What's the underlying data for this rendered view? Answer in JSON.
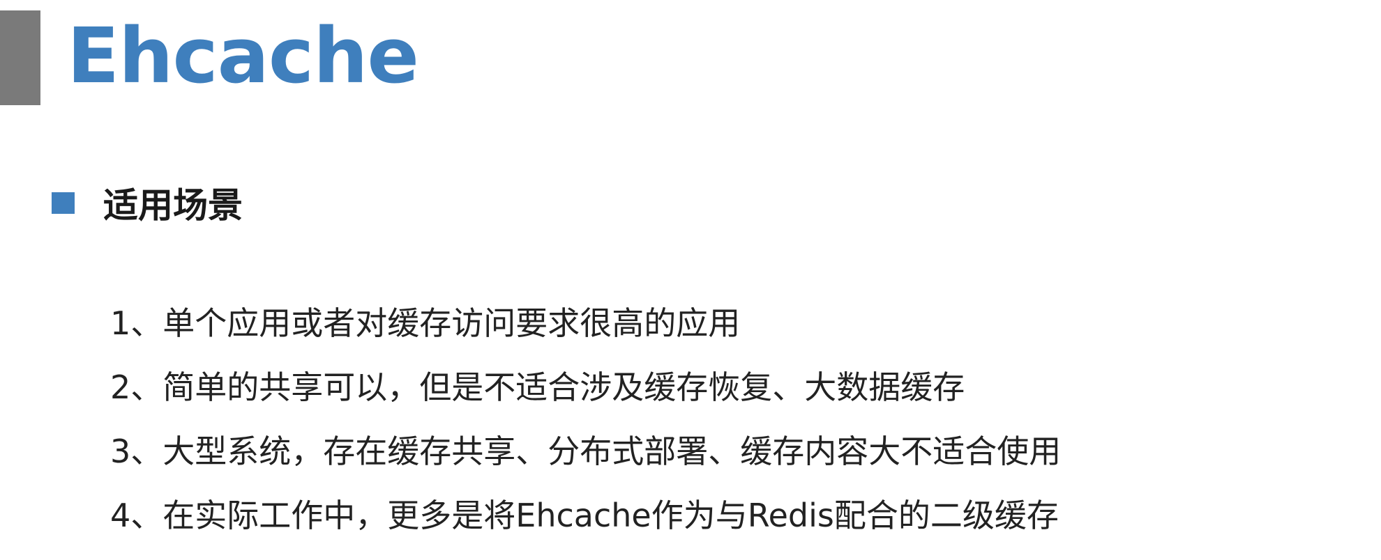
{
  "slide": {
    "title": "Ehcache",
    "section": {
      "label": "适用场景",
      "items": [
        "1、单个应用或者对缓存访问要求很高的应用",
        "2、简单的共享可以，但是不适合涉及缓存恢复、大数据缓存",
        "3、大型系统，存在缓存共享、分布式部署、缓存内容大不适合使用",
        "4、在实际工作中，更多是将Ehcache作为与Redis配合的二级缓存"
      ]
    },
    "colors": {
      "accent_blue": "#3f7fbd",
      "title_bar_gray": "#7a7a7a",
      "text": "#222222"
    }
  }
}
